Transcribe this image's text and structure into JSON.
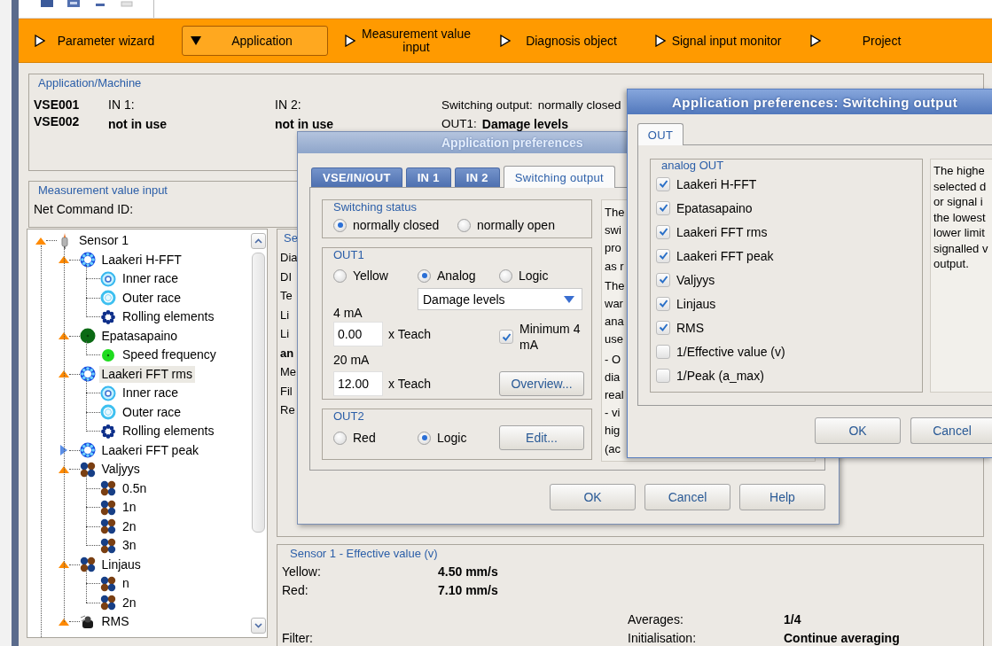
{
  "nav": [
    {
      "label": "Parameter wizard",
      "selected": false
    },
    {
      "label": "Application",
      "selected": true
    },
    {
      "label": "Measurement value input",
      "selected": false
    },
    {
      "label": "Diagnosis object",
      "selected": false
    },
    {
      "label": "Signal input monitor",
      "selected": false
    },
    {
      "label": "Project",
      "selected": false
    }
  ],
  "application_machine": {
    "title": "Application/Machine",
    "devices": [
      "VSE001",
      "VSE002"
    ],
    "inputs": [
      {
        "label": "IN 1:",
        "value": "not in use"
      },
      {
        "label": "IN 2:",
        "value": "not in use"
      }
    ],
    "switching_output": {
      "label": "Switching output:",
      "value": "normally closed"
    },
    "out1": {
      "label": "OUT1:",
      "value": "Damage levels"
    }
  },
  "measurement_value_input": {
    "title": "Measurement value input",
    "net_command_label": "Net Command ID:"
  },
  "tree": [
    {
      "label": "Sensor 1",
      "kind": "sensor",
      "expanded": true,
      "selected": false,
      "children": [
        {
          "label": "Laakeri H-FFT",
          "kind": "bearing",
          "expanded": true,
          "selected": false,
          "children": [
            {
              "label": "Inner race",
              "kind": "inner-race",
              "selected": false
            },
            {
              "label": "Outer race",
              "kind": "outer-race",
              "selected": false
            },
            {
              "label": "Rolling elements",
              "kind": "rolling",
              "selected": false
            }
          ]
        },
        {
          "label": "Epatasapaino",
          "kind": "unbalance",
          "expanded": true,
          "selected": false,
          "children": [
            {
              "label": "Speed frequency",
              "kind": "speed",
              "selected": false
            }
          ]
        },
        {
          "label": "Laakeri FFT rms",
          "kind": "bearing",
          "expanded": true,
          "selected": true,
          "children": [
            {
              "label": "Inner race",
              "kind": "inner-race",
              "selected": false
            },
            {
              "label": "Outer race",
              "kind": "outer-race",
              "selected": false
            },
            {
              "label": "Rolling elements",
              "kind": "rolling",
              "selected": false
            }
          ]
        },
        {
          "label": "Laakeri FFT peak",
          "kind": "bearing",
          "expanded": false,
          "selected": false
        },
        {
          "label": "Valjyys",
          "kind": "cluster",
          "expanded": true,
          "selected": false,
          "children": [
            {
              "label": "0.5n",
              "kind": "cluster",
              "selected": false
            },
            {
              "label": "1n",
              "kind": "cluster",
              "selected": false
            },
            {
              "label": "2n",
              "kind": "cluster",
              "selected": false
            },
            {
              "label": "3n",
              "kind": "cluster",
              "selected": false
            }
          ]
        },
        {
          "label": "Linjaus",
          "kind": "cluster",
          "expanded": true,
          "selected": false,
          "children": [
            {
              "label": "n",
              "kind": "cluster",
              "selected": false
            },
            {
              "label": "2n",
              "kind": "cluster",
              "selected": false
            }
          ]
        },
        {
          "label": "RMS",
          "kind": "rms",
          "expanded": true,
          "selected": false
        }
      ]
    }
  ],
  "detail_panel": {
    "title": "Se",
    "labels": [
      {
        "text": "Dia",
        "bold": false
      },
      {
        "text": "DI",
        "bold": false
      },
      {
        "text": "Te",
        "bold": false
      },
      {
        "text": "Li",
        "bold": false
      },
      {
        "text": "Li",
        "bold": false
      },
      {
        "text": "an",
        "bold": true
      },
      {
        "text": "Me",
        "bold": false
      },
      {
        "text": "Fil",
        "bold": false
      },
      {
        "text": "Re",
        "bold": false
      }
    ]
  },
  "effective_value_panel": {
    "title": "Sensor 1  -  Effective value (v)",
    "rows": [
      {
        "label": "Yellow:",
        "value": "4.50 mm/s"
      },
      {
        "label": "Red:",
        "value": "7.10 mm/s"
      }
    ],
    "averages": {
      "label": "Averages:",
      "value": "1/4"
    },
    "filter_label": "Filter:",
    "initialisation": {
      "label": "Initialisation:",
      "value": "Continue averaging"
    }
  },
  "dialog_main": {
    "title": "Application preferences",
    "tabs": [
      {
        "label": "VSE/IN/OUT",
        "selected": false
      },
      {
        "label": "IN 1",
        "selected": false
      },
      {
        "label": "IN 2",
        "selected": false
      },
      {
        "label": "Switching output",
        "selected": true
      }
    ],
    "switching_status": {
      "title": "Switching status",
      "options": [
        {
          "label": "normally closed",
          "selected": true
        },
        {
          "label": "normally open",
          "selected": false
        }
      ]
    },
    "out1": {
      "title": "OUT1",
      "options": [
        {
          "label": "Yellow",
          "selected": false
        },
        {
          "label": "Analog",
          "selected": true
        },
        {
          "label": "Logic",
          "selected": false
        }
      ],
      "dropdown": "Damage levels",
      "low_label": "4 mA",
      "low_value": "0.00",
      "low_unit": "x Teach",
      "high_label": "20 mA",
      "high_value": "12.00",
      "high_unit": "x Teach",
      "minimum": {
        "label": "Minimum 4 mA",
        "checked": true
      },
      "overview_button": "Overview..."
    },
    "out2": {
      "title": "OUT2",
      "options": [
        {
          "label": "Red",
          "selected": false
        },
        {
          "label": "Logic",
          "selected": true
        }
      ],
      "edit_button": "Edit..."
    },
    "description": [
      [
        "The",
        "swi",
        "pro",
        "as r"
      ],
      [
        "The",
        "war",
        "ana",
        "use"
      ],
      [
        "- O",
        "dia",
        "real",
        "- vi",
        "hig",
        "(ac"
      ]
    ],
    "buttons": [
      "OK",
      "Cancel",
      "Help"
    ]
  },
  "dialog_output": {
    "title": "Application preferences: Switching output",
    "tabs": [
      {
        "label": "OUT",
        "selected": true
      }
    ],
    "group_title": "analog OUT",
    "items": [
      {
        "label": "Laakeri H-FFT",
        "checked": true
      },
      {
        "label": "Epatasapaino",
        "checked": true
      },
      {
        "label": "Laakeri FFT rms",
        "checked": true
      },
      {
        "label": "Laakeri FFT peak",
        "checked": true
      },
      {
        "label": "Valjyys",
        "checked": true
      },
      {
        "label": "Linjaus",
        "checked": true
      },
      {
        "label": "RMS",
        "checked": true
      },
      {
        "label": "1/Effective value (v)",
        "checked": false
      },
      {
        "label": "1/Peak (a_max)",
        "checked": false
      }
    ],
    "description": [
      "The highe",
      "selected d",
      "or signal i",
      "the lowest",
      "lower limit",
      "signalled v",
      "output."
    ],
    "buttons": [
      "OK",
      "Cancel"
    ]
  }
}
